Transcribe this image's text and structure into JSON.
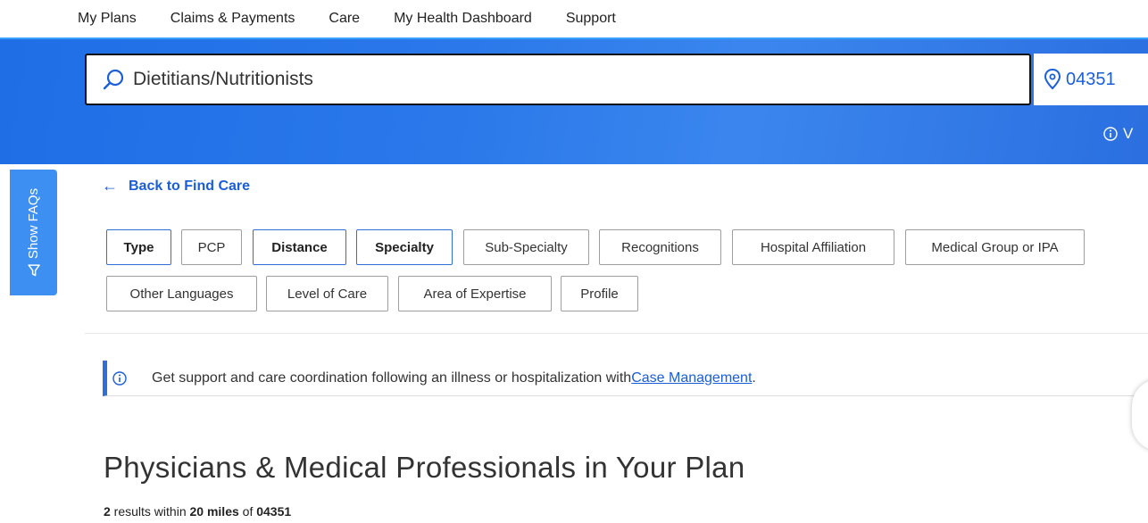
{
  "top_nav": {
    "items": [
      "My Plans",
      "Claims & Payments",
      "Care",
      "My Health Dashboard",
      "Support"
    ]
  },
  "search": {
    "value": "Dietitians/Nutritionists",
    "zip_display": "04351"
  },
  "banner": {
    "view_link_text": "V"
  },
  "faq_tab": {
    "label": "Show FAQs"
  },
  "back_link": {
    "label": "Back to Find Care"
  },
  "filters": {
    "row1": [
      "Type",
      "PCP",
      "Distance",
      "Specialty",
      "Sub-Specialty",
      "Recognitions",
      "Hospital Affiliation",
      "Medical Group or IPA"
    ],
    "row2": [
      "Other Languages",
      "Level of Care",
      "Area of Expertise",
      "Profile"
    ],
    "active": [
      "Type",
      "Distance",
      "Specialty"
    ]
  },
  "info_bar": {
    "text": "Get support and care coordination following an illness or hospitalization with ",
    "link": "Case Management",
    "suffix": "."
  },
  "results": {
    "title": "Physicians & Medical Professionals in Your Plan",
    "count": "2",
    "word_results": " results within ",
    "distance": "20 miles",
    "word_of": " of ",
    "zip": "04351"
  },
  "colors": {
    "primary_blue": "#1a5ed8",
    "banner_blue": "#2a78ea",
    "faq_blue": "#3d8ff2"
  }
}
